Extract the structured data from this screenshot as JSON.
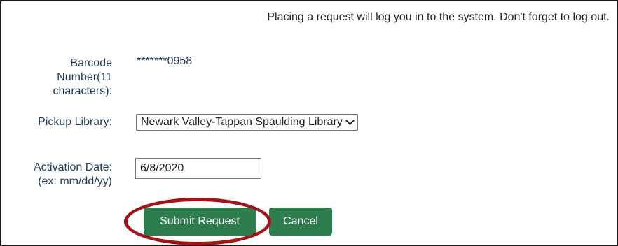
{
  "notice": "Placing a request will log you in to the system. Don't forget to log out.",
  "barcode": {
    "label_line1": "Barcode",
    "label_line2": "Number(11",
    "label_line3": "characters):",
    "value": "*******0958"
  },
  "pickup": {
    "label": "Pickup Library:",
    "selected": "Newark Valley-Tappan Spaulding Library"
  },
  "activation": {
    "label_line1": "Activation Date:",
    "label_line2": "(ex: mm/dd/yy)",
    "value": "6/8/2020"
  },
  "buttons": {
    "submit": "Submit Request",
    "cancel": "Cancel"
  },
  "colors": {
    "button_bg": "#2e7d4f",
    "label_text": "#243c5a",
    "annotation_circle": "#a3141a"
  }
}
